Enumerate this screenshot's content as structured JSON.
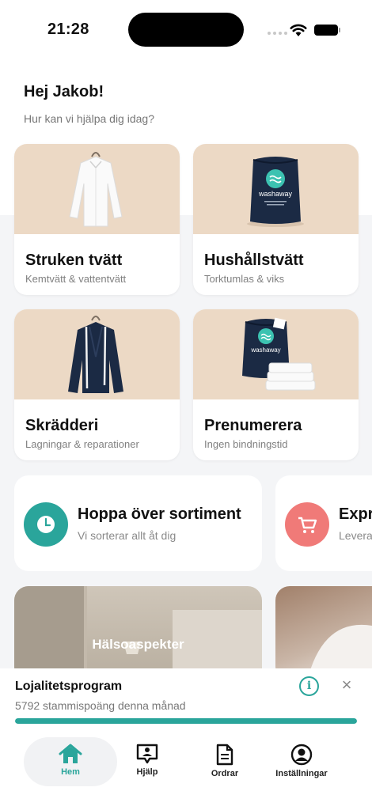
{
  "status_bar": {
    "time": "21:28"
  },
  "greeting": {
    "title": "Hej Jakob!",
    "subtitle": "Hur kan vi hjälpa dig idag?"
  },
  "services": [
    {
      "title": "Struken tvätt",
      "subtitle": "Kemtvätt & vattentvätt"
    },
    {
      "title": "Hushållstvätt",
      "subtitle": "Torktumlas & viks",
      "bag_brand": "washaway"
    },
    {
      "title": "Skrädderi",
      "subtitle": "Lagningar & reparationer"
    },
    {
      "title": "Prenumerera",
      "subtitle": "Ingen bindningstid",
      "bag_brand": "washaway"
    }
  ],
  "quick_actions": [
    {
      "title": "Hoppa över sortiment",
      "subtitle": "Vi sorterar allt åt dig",
      "icon": "clock-icon",
      "color": "#2aa59b"
    },
    {
      "title": "Expr",
      "subtitle": "Levera",
      "icon": "cart-icon",
      "color": "#f07a78"
    }
  ],
  "articles": [
    {
      "title": "Hälsoaspekter"
    },
    {
      "title": ""
    }
  ],
  "loyalty": {
    "title": "Lojalitetsprogram",
    "subtitle": "5792 stammispoäng denna månad",
    "progress_percent": 100
  },
  "tabs": [
    {
      "label": "Hem",
      "icon": "home-icon",
      "active": true
    },
    {
      "label": "Hjälp",
      "icon": "chat-icon",
      "active": false
    },
    {
      "label": "Ordrar",
      "icon": "document-icon",
      "active": false
    },
    {
      "label": "Inställningar",
      "icon": "profile-icon",
      "active": false
    }
  ],
  "colors": {
    "accent": "#2aa59b",
    "coral": "#f07a78",
    "card_bg": "#ecd9c5",
    "bag_navy": "#1b2a44"
  }
}
